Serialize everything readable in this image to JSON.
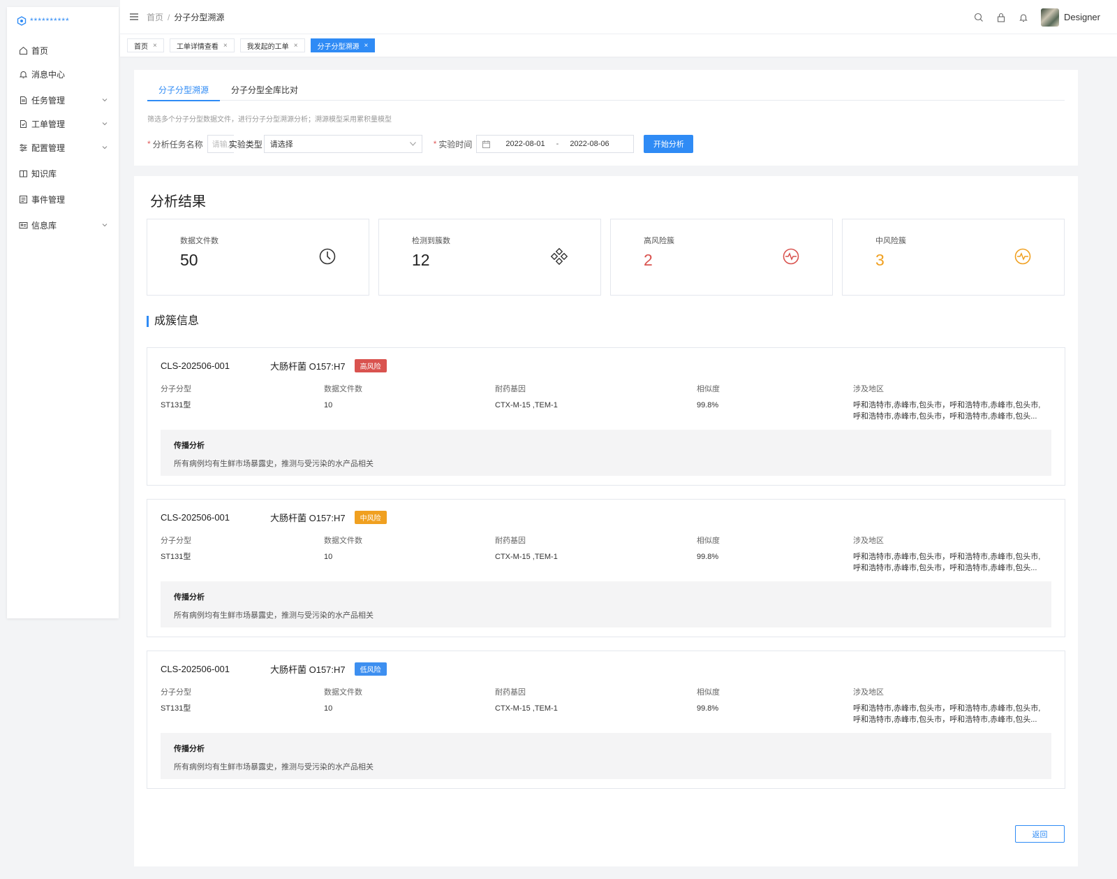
{
  "logo": {
    "text": "**********"
  },
  "sidebar": {
    "items": [
      {
        "label": "首页",
        "icon": "home-icon",
        "expandable": false
      },
      {
        "label": "消息中心",
        "icon": "bell-icon",
        "expandable": false
      },
      {
        "label": "任务管理",
        "icon": "task-document-icon",
        "expandable": true
      },
      {
        "label": "工单管理",
        "icon": "work-order-icon",
        "expandable": true
      },
      {
        "label": "配置管理",
        "icon": "sliders-icon",
        "expandable": true
      },
      {
        "label": "知识库",
        "icon": "book-icon",
        "expandable": false
      },
      {
        "label": "事件管理",
        "icon": "event-icon",
        "expandable": false
      },
      {
        "label": "信息库",
        "icon": "id-card-icon",
        "expandable": true
      }
    ]
  },
  "header": {
    "breadcrumb": {
      "home": "首页",
      "separator": "/",
      "current": "分子分型溯源"
    },
    "user": {
      "name": "Designer"
    }
  },
  "page_tabs": [
    {
      "label": "首页",
      "close": "×",
      "active": false
    },
    {
      "label": "工单详情查看",
      "close": "×",
      "active": false
    },
    {
      "label": "我发起的工单",
      "close": "×",
      "active": false
    },
    {
      "label": "分子分型溯源",
      "close": "×",
      "active": true
    }
  ],
  "filter": {
    "tabs": [
      {
        "label": "分子分型溯源",
        "active": true
      },
      {
        "label": "分子分型全库比对",
        "active": false
      }
    ],
    "hint": "筛选多个分子分型数据文件，进行分子分型溯源分析；溯源模型采用累积量模型",
    "task_name_label": "分析任务名称",
    "task_name_placeholder": "请输入",
    "exp_type_label": "实验类型",
    "exp_type_value": "请选择",
    "time_label": "实验时间",
    "date_start": "2022-08-01",
    "date_sep": "-",
    "date_end": "2022-08-06",
    "submit_label": "开始分析"
  },
  "results": {
    "title": "分析结果",
    "stats": [
      {
        "label": "数据文件数",
        "value": "50",
        "icon": "clock-icon",
        "color": "#222222"
      },
      {
        "label": "检测到簇数",
        "value": "12",
        "icon": "cluster-icon",
        "color": "#222222"
      },
      {
        "label": "高风险簇",
        "value": "2",
        "icon": "pulse-icon",
        "color": "#d9534f"
      },
      {
        "label": "中风险簇",
        "value": "3",
        "icon": "pulse-icon",
        "color": "#f0a020"
      }
    ],
    "section_title": "成簇信息",
    "cluster_labels": {
      "type": "分子分型",
      "files": "数据文件数",
      "genes": "耐药基因",
      "similarity": "相似度",
      "regions": "涉及地区",
      "propagation": "传播分析"
    },
    "clusters": [
      {
        "id": "CLS-202506-001",
        "name": "大肠杆菌 O157:H7",
        "risk": "高风险",
        "risk_color": "#d9534f",
        "type": "ST131型",
        "files": "10",
        "genes": "CTX-M-15 ,TEM-1",
        "similarity": "99.8%",
        "regions_line1": "呼和浩特市,赤峰市,包头市，呼和浩特市,赤峰市,包头市,",
        "regions_line2": "呼和浩特市,赤峰市,包头市，呼和浩特市,赤峰市,包头...",
        "propagation": "所有病例均有生鲜市场暴露史，推测与受污染的水产品相关"
      },
      {
        "id": "CLS-202506-001",
        "name": "大肠杆菌 O157:H7",
        "risk": "中风险",
        "risk_color": "#f0a020",
        "type": "ST131型",
        "files": "10",
        "genes": "CTX-M-15 ,TEM-1",
        "similarity": "99.8%",
        "regions_line1": "呼和浩特市,赤峰市,包头市，呼和浩特市,赤峰市,包头市,",
        "regions_line2": "呼和浩特市,赤峰市,包头市，呼和浩特市,赤峰市,包头...",
        "propagation": "所有病例均有生鲜市场暴露史，推测与受污染的水产品相关"
      },
      {
        "id": "CLS-202506-001",
        "name": "大肠杆菌 O157:H7",
        "risk": "低风险",
        "risk_color": "#3d8ff0",
        "type": "ST131型",
        "files": "10",
        "genes": "CTX-M-15 ,TEM-1",
        "similarity": "99.8%",
        "regions_line1": "呼和浩特市,赤峰市,包头市，呼和浩特市,赤峰市,包头市,",
        "regions_line2": "呼和浩特市,赤峰市,包头市，呼和浩特市,赤峰市,包头...",
        "propagation": "所有病例均有生鲜市场暴露史，推测与受污染的水产品相关"
      }
    ],
    "back_label": "返回"
  },
  "colors": {
    "accent": "#2f8bf5",
    "high_risk": "#d9534f",
    "mid_risk": "#f0a020",
    "low_risk": "#3d8ff0"
  }
}
